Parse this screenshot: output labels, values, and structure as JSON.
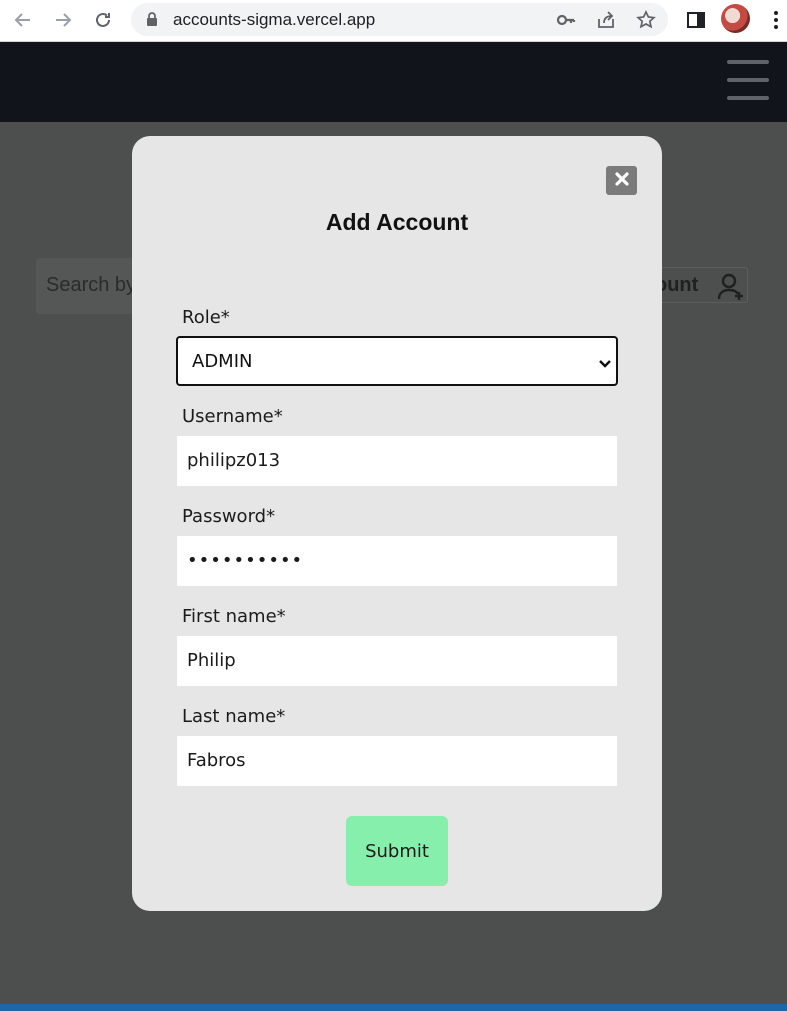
{
  "browser": {
    "url": "accounts-sigma.vercel.app"
  },
  "background": {
    "search_placeholder": "Search by",
    "add_account_label": "ount"
  },
  "modal": {
    "title": "Add Account",
    "close_symbol": "✖",
    "fields": {
      "role": {
        "label": "Role*",
        "value": "ADMIN"
      },
      "username": {
        "label": "Username*",
        "value": "philipz013"
      },
      "password": {
        "label": "Password*",
        "value": "••••••••••"
      },
      "first_name": {
        "label": "First name*",
        "value": "Philip"
      },
      "last_name": {
        "label": "Last name*",
        "value": "Fabros"
      }
    },
    "submit_label": "Submit"
  },
  "colors": {
    "header_bg": "#11151b",
    "overlay_bg": "#4d4f4e",
    "modal_bg": "#e6e6e6",
    "submit_bg": "#86efac",
    "close_bg": "#7b7b7b"
  }
}
